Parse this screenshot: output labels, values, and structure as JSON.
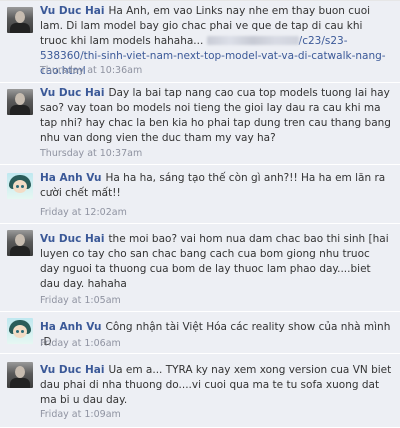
{
  "comments": [
    {
      "author": "Vu Duc Hai",
      "text": "Ha Anh, em vao Links nay nhe em thay buon cuoi lam. Di lam model bay gio chac phai ve que de tap di cau khi truoc khi lam models hahaha...",
      "link_tail": "c23/s23-538360/thi-sinh-viet-nam-next-top-model-vat-va-di-catwalk-nang-cao.html",
      "time": "Thursday at 10:36am",
      "avatar": "man"
    },
    {
      "author": "Vu Duc Hai",
      "text": "Day la bai tap nang cao cua top models tuong lai hay sao? vay toan bo models noi tieng the gioi lay dau ra cau khi ma tap nhi? hay chac la ben kia ho phai tap dung tren cau thang bang nhu van dong vien the duc tham my vay ha?",
      "time": "Thursday at 10:37am",
      "avatar": "man"
    },
    {
      "author": "Ha Anh Vu",
      "text": "Ha ha ha, sáng tạo thế còn gì anh?!! Ha ha em lăn ra cười chết mất!!",
      "time": "Friday at 12:02am",
      "avatar": "girl"
    },
    {
      "author": "Vu Duc Hai",
      "text": "the moi bao? vai hom nua dam chac bao thi sinh [hai luyen co tay cho san chac bang cach cua bom giong nhu truoc day nguoi ta thuong cua bom de lay thuoc lam phao day....biet dau day. hahaha",
      "time": "Friday at 1:05am",
      "avatar": "man"
    },
    {
      "author": "Ha Anh Vu",
      "text": "Công nhận tài Việt Hóa các reality show của nhà mình :D",
      "time": "Friday at 1:06am",
      "avatar": "girl"
    },
    {
      "author": "Vu Duc Hai",
      "text": "Ua em a... TYRA ky nay xem xong version cua VN biet dau phai di nha thuong do....vi cuoi qua ma te tu sofa xuong dat ma bi u dau day.",
      "time": "Friday at 1:09am",
      "avatar": "man"
    }
  ]
}
